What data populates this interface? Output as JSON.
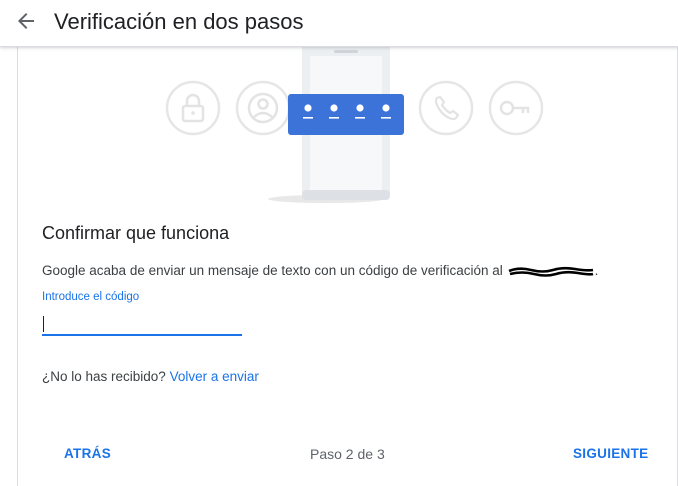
{
  "header": {
    "title": "Verificación en dos pasos",
    "back_icon": "arrow-back-icon"
  },
  "illustration": {
    "icons": [
      "lock-icon",
      "account-circle-icon",
      "phone-code-icon",
      "phone-call-icon",
      "key-icon"
    ],
    "code_dots": 4,
    "colors": {
      "accent": "#3b73d9",
      "circle_stroke": "#e6e6e6",
      "phone_body": "#eceff1"
    }
  },
  "main": {
    "section_title": "Confirmar que funciona",
    "sent_text": "Google acaba de enviar un mensaje de texto con un código de verificación al",
    "sent_text_suffix": ".",
    "input_label": "Introduce el código",
    "input_value": "",
    "resend_question": "¿No lo has recibido?",
    "resend_link": "Volver a enviar"
  },
  "footer": {
    "back_label": "ATRÁS",
    "step_text": "Paso 2 de 3",
    "next_label": "SIGUIENTE"
  },
  "colors": {
    "link": "#1a73e8",
    "text_primary": "#202124",
    "text_secondary": "#3c4043",
    "muted": "#5f6368",
    "border": "#dadce0"
  }
}
